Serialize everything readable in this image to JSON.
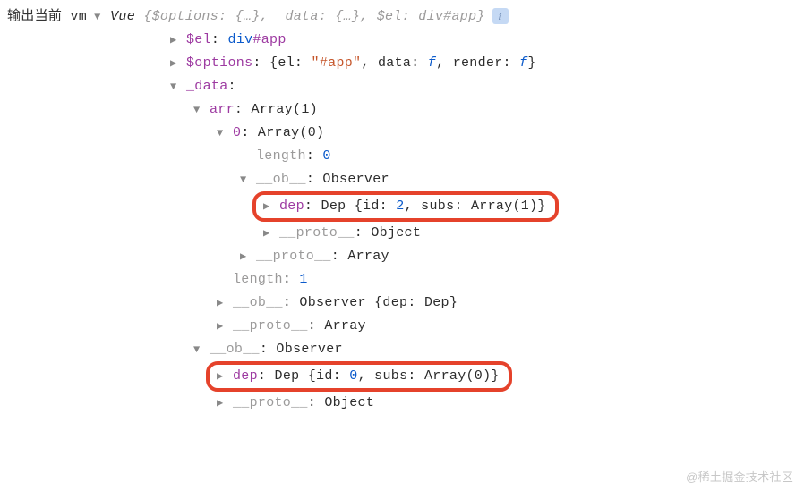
{
  "topRow": {
    "prefix": "输出当前 vm",
    "vueLabel": "Vue",
    "summary": " {$options: {…}, _data: {…}, $el: div#app}"
  },
  "lines": {
    "elKey": "$el",
    "elVal": "div#app",
    "optionsKey": "$options",
    "optionsElKey": "el: ",
    "optionsElVal": "\"#app\"",
    "optionsData": "data: ",
    "optionsDataVal": "f",
    "optionsRender": "render: ",
    "optionsRenderVal": "f",
    "dataKey": "_data",
    "arrKey": "arr",
    "arrType": "Array(1)",
    "idx0Key": "0",
    "idx0Type": "Array(0)",
    "lengthKey": "length",
    "length0": "0",
    "obKey": "__ob__",
    "observer": "Observer",
    "depKey": "dep",
    "depClass": "Dep",
    "depId2": "id: ",
    "depId2Val": "2",
    "depSubs1": "subs: ",
    "depSubs1Val": "Array(1)",
    "protoKey": "__proto__",
    "protoObject": "Object",
    "protoArray": "Array",
    "length1": "1",
    "observerDep": "Observer {dep: Dep}",
    "depId0": "id: ",
    "depId0Val": "0",
    "depSubs0": "subs: ",
    "depSubs0Val": "Array(0)"
  },
  "watermark": "@稀土掘金技术社区"
}
